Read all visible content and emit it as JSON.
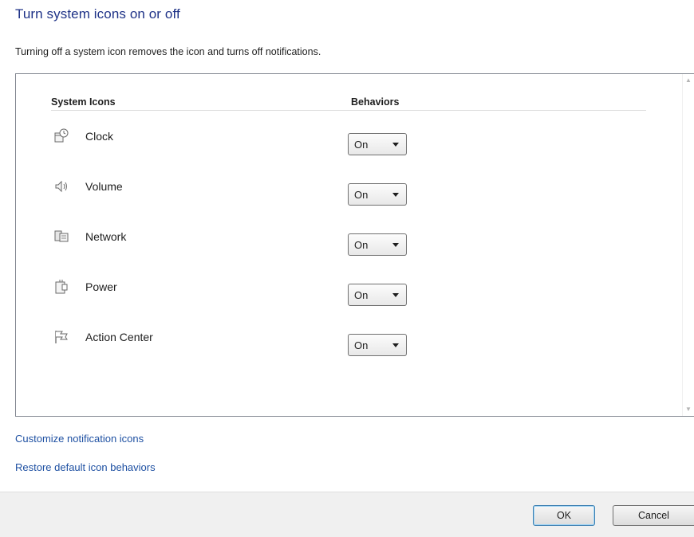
{
  "title": "Turn system icons on or off",
  "subtitle": "Turning off a system icon removes the icon and turns off notifications.",
  "columns": {
    "icons": "System Icons",
    "behaviors": "Behaviors"
  },
  "rows": [
    {
      "label": "Clock",
      "icon": "clock-icon",
      "value": "On"
    },
    {
      "label": "Volume",
      "icon": "volume-icon",
      "value": "On"
    },
    {
      "label": "Network",
      "icon": "network-icon",
      "value": "On"
    },
    {
      "label": "Power",
      "icon": "power-icon",
      "value": "On"
    },
    {
      "label": "Action Center",
      "icon": "action-center-flag-icon",
      "value": "On"
    }
  ],
  "links": {
    "customize": "Customize notification icons",
    "restore": "Restore default icon behaviors"
  },
  "buttons": {
    "ok": "OK",
    "cancel": "Cancel"
  },
  "colors": {
    "title": "#1e3287",
    "link": "#1e50a2",
    "footer_bg": "#f0f0f0"
  }
}
